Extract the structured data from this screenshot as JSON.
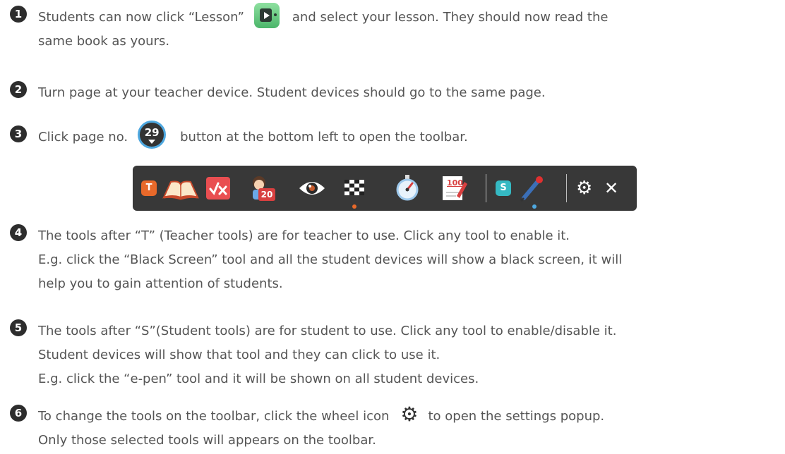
{
  "steps": [
    {
      "num": "1",
      "text_a": "Students can now click “Lesson”",
      "text_b": "and select your lesson. They should now read the",
      "text_c": "same  book as yours."
    },
    {
      "num": "2",
      "text_a": "Turn page at your teacher device. Student devices should go to the same page."
    },
    {
      "num": "3",
      "text_a": "Click page no.",
      "page_no": "29",
      "text_b": "button at the bottom left to open the toolbar."
    },
    {
      "num": "4",
      "line1": "The tools after “T” (Teacher tools) are for teacher to use. Click any tool to enable it.",
      "line2": "E.g. click the “Black Screen” tool and all the student devices will show a black screen, it will",
      "line3": "help you to gain attention of students."
    },
    {
      "num": "5",
      "line1": "The tools after “S”(Student tools) are for student to use. Click any tool to enable/disable it.",
      "line2": "Student devices will show that tool and they can click to use it.",
      "line3": "E.g. click the “e-pen” tool and it will be shown on all student devices."
    },
    {
      "num": "6",
      "text_a": "To change the tools on the toolbar, click the wheel icon",
      "text_b": "to open the settings popup.",
      "line2": "Only those selected tools will appears on the toolbar."
    }
  ],
  "toolbar": {
    "teacher_badge": "T",
    "student_badge": "S",
    "student_count": "20",
    "score_text": "100",
    "colors": {
      "background": "#383838",
      "teacher": "#e8692a",
      "student": "#35b9c3",
      "active_dot_orange": "#e8692a",
      "active_dot_blue": "#4ea8e0"
    }
  }
}
